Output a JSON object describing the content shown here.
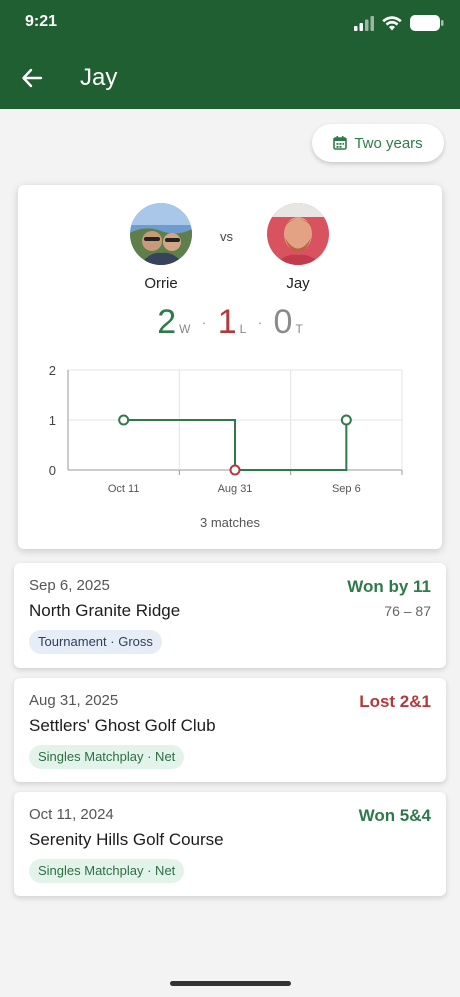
{
  "status": {
    "time": "9:21"
  },
  "header": {
    "title": "Jay"
  },
  "filter": {
    "label": "Two years"
  },
  "summary": {
    "left_player": "Orrie",
    "right_player": "Jay",
    "vs": "vs",
    "wins": "2",
    "wins_label": "W",
    "losses": "1",
    "losses_label": "L",
    "ties": "0",
    "ties_label": "T",
    "separator": "·",
    "matches_count": "3 matches"
  },
  "chart_data": {
    "type": "line",
    "categories": [
      "Oct 11",
      "Aug 31",
      "Sep 6"
    ],
    "series": [
      {
        "values": [
          1,
          0,
          1
        ]
      }
    ],
    "ylim": [
      0,
      2
    ],
    "yticks": [
      "0",
      "1",
      "2"
    ],
    "grid": true,
    "title": "",
    "xlabel": "",
    "ylabel": ""
  },
  "colors": {
    "brand": "#1f5f32",
    "win": "#2f7a4b",
    "loss": "#b23a3a",
    "tie": "#8a8a8a"
  },
  "matches": [
    {
      "date": "Sep 6, 2025",
      "course": "North Granite Ridge",
      "result": "Won by 11",
      "outcome": "win",
      "score": "76 – 87",
      "tag": "Tournament · Gross"
    },
    {
      "date": "Aug 31, 2025",
      "course": "Settlers' Ghost Golf Club",
      "result": "Lost 2&1",
      "outcome": "loss",
      "score": "",
      "tag": "Singles Matchplay · Net"
    },
    {
      "date": "Oct 11, 2024",
      "course": "Serenity Hills Golf Course",
      "result": "Won 5&4",
      "outcome": "win",
      "score": "",
      "tag": "Singles Matchplay · Net"
    }
  ]
}
